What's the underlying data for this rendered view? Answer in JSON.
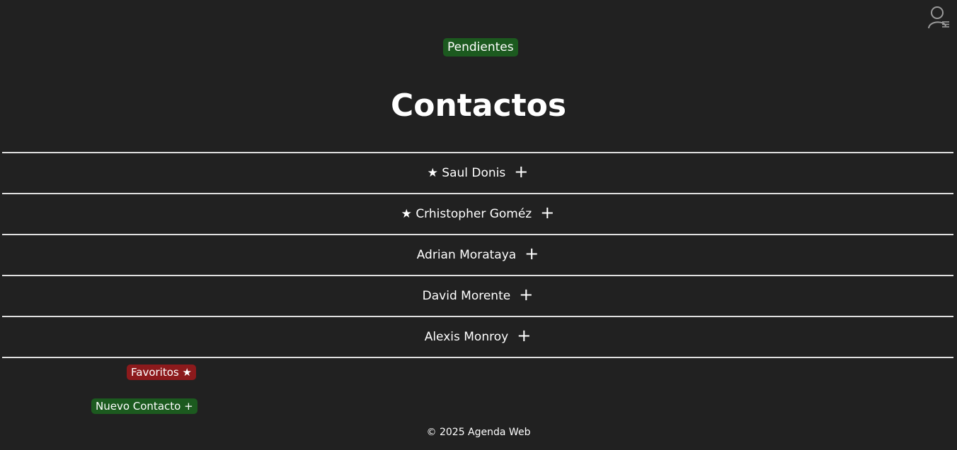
{
  "header": {
    "user_menu_icon": "user-menu-icon",
    "pending_label": "Pendientes",
    "pending_color": "#1c5a1f"
  },
  "main": {
    "title": "Contactos",
    "contacts": [
      {
        "star": "★",
        "name": "Saul Donis",
        "favorite": true,
        "add": "+"
      },
      {
        "star": "★",
        "name": "Crhistopher Goméz",
        "favorite": true,
        "add": "+"
      },
      {
        "star": "",
        "name": "Adrian Morataya",
        "favorite": false,
        "add": "+"
      },
      {
        "star": "",
        "name": "David Morente",
        "favorite": false,
        "add": "+"
      },
      {
        "star": "",
        "name": "Alexis Monroy",
        "favorite": false,
        "add": "+"
      }
    ]
  },
  "actions": {
    "favorites_label": "Favoritos ★",
    "favorites_color": "#8c1a1c",
    "new_contact_label": "Nuevo Contacto +",
    "new_contact_color": "#1c5a1f"
  },
  "footer": {
    "text": "© 2025 Agenda Web"
  },
  "colors": {
    "background": "#212121",
    "text": "#ffffff",
    "divider": "#e0e0e0"
  }
}
